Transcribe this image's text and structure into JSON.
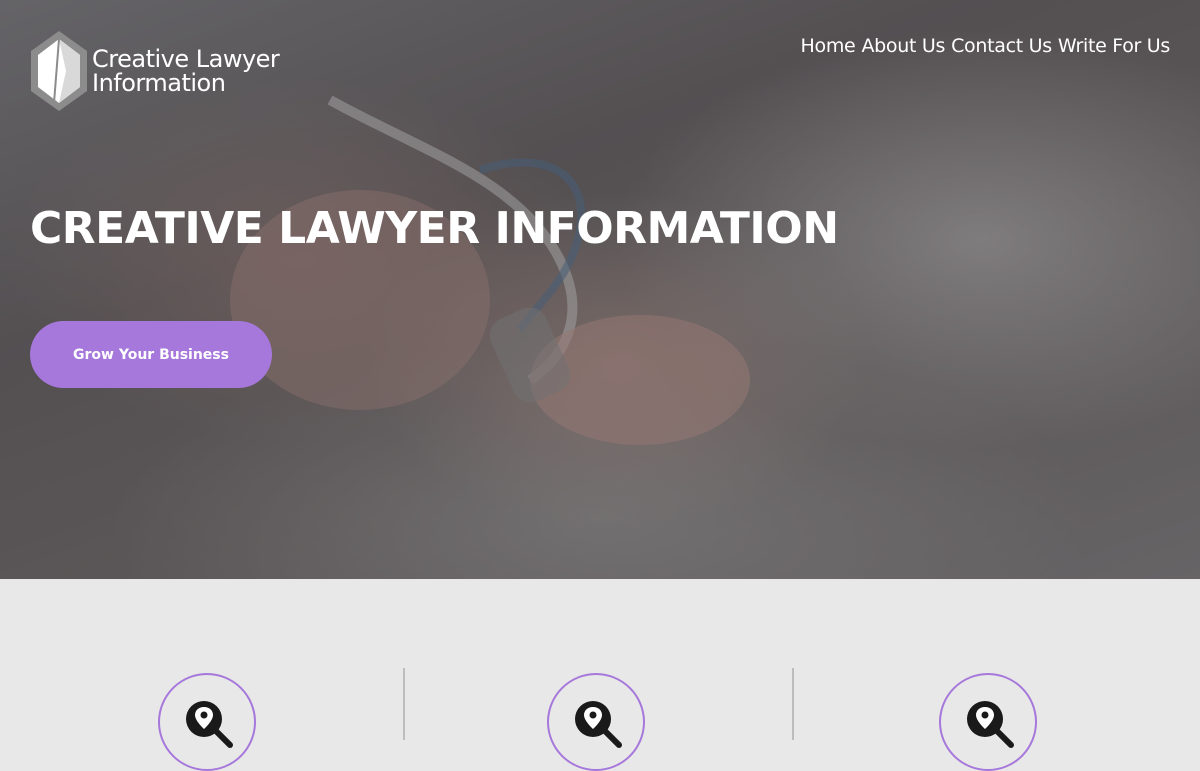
{
  "site": {
    "logo_line1": "Creative Lawyer",
    "logo_line2": "Information"
  },
  "nav": {
    "items": [
      {
        "label": "Home"
      },
      {
        "label": "About Us"
      },
      {
        "label": "Contact Us"
      },
      {
        "label": "Write For Us"
      }
    ]
  },
  "hero": {
    "title": "CREATIVE LAWYER INFORMATION",
    "cta_label": "Grow Your Business"
  },
  "features": {
    "icons": [
      "location-search-icon",
      "location-search-icon",
      "location-search-icon"
    ],
    "accent": "#a678db"
  },
  "colors": {
    "accent": "#a678db",
    "section_bg": "#e8e8e8"
  }
}
